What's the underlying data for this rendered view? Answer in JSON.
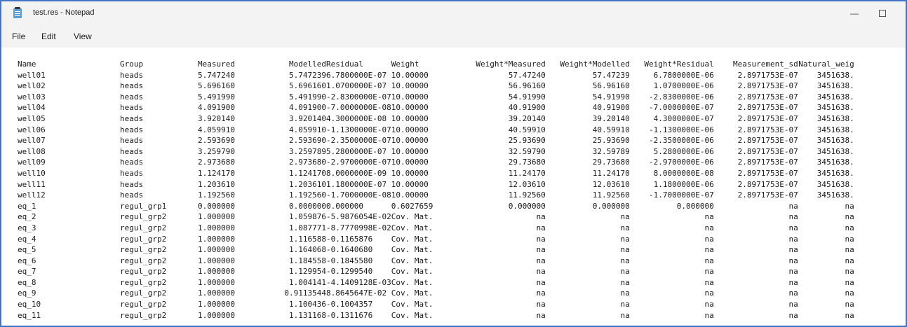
{
  "window": {
    "title": "test.res - Notepad",
    "minimize_glyph": "—",
    "icon": "notepad-icon"
  },
  "menu": [
    "File",
    "Edit",
    "View"
  ],
  "table": {
    "headers": [
      "Name",
      "Group",
      "Measured",
      "Modelled",
      "Residual",
      "Weight",
      "Weight*Measured",
      "Weight*Modelled",
      "Weight*Residual",
      "Measurement_sd",
      "Natural_weig"
    ],
    "rows": [
      [
        "well01",
        "heads",
        "5.747240",
        "5.747239",
        "6.7800000E-07",
        "10.00000",
        "57.47240",
        "57.47239",
        "6.7800000E-06",
        "2.8971753E-07",
        "3451638."
      ],
      [
        "well02",
        "heads",
        "5.696160",
        "5.696160",
        "1.0700000E-07",
        "10.00000",
        "56.96160",
        "56.96160",
        "1.0700000E-06",
        "2.8971753E-07",
        "3451638."
      ],
      [
        "well03",
        "heads",
        "5.491990",
        "5.491990",
        "-2.8300000E-07",
        "10.00000",
        "54.91990",
        "54.91990",
        "-2.8300000E-06",
        "2.8971753E-07",
        "3451638."
      ],
      [
        "well04",
        "heads",
        "4.091900",
        "4.091900",
        "-7.0000000E-08",
        "10.00000",
        "40.91900",
        "40.91900",
        "-7.0000000E-07",
        "2.8971753E-07",
        "3451638."
      ],
      [
        "well05",
        "heads",
        "3.920140",
        "3.920140",
        "4.3000000E-08",
        "10.00000",
        "39.20140",
        "39.20140",
        "4.3000000E-07",
        "2.8971753E-07",
        "3451638."
      ],
      [
        "well06",
        "heads",
        "4.059910",
        "4.059910",
        "-1.1300000E-07",
        "10.00000",
        "40.59910",
        "40.59910",
        "-1.1300000E-06",
        "2.8971753E-07",
        "3451638."
      ],
      [
        "well07",
        "heads",
        "2.593690",
        "2.593690",
        "-2.3500000E-07",
        "10.00000",
        "25.93690",
        "25.93690",
        "-2.3500000E-06",
        "2.8971753E-07",
        "3451638."
      ],
      [
        "well08",
        "heads",
        "3.259790",
        "3.259789",
        "5.2800000E-07",
        "10.00000",
        "32.59790",
        "32.59789",
        "5.2800000E-06",
        "2.8971753E-07",
        "3451638."
      ],
      [
        "well09",
        "heads",
        "2.973680",
        "2.973680",
        "-2.9700000E-07",
        "10.00000",
        "29.73680",
        "29.73680",
        "-2.9700000E-06",
        "2.8971753E-07",
        "3451638."
      ],
      [
        "well10",
        "heads",
        "1.124170",
        "1.124170",
        "8.0000000E-09",
        "10.00000",
        "11.24170",
        "11.24170",
        "8.0000000E-08",
        "2.8971753E-07",
        "3451638."
      ],
      [
        "well11",
        "heads",
        "1.203610",
        "1.203610",
        "1.1800000E-07",
        "10.00000",
        "12.03610",
        "12.03610",
        "1.1800000E-06",
        "2.8971753E-07",
        "3451638."
      ],
      [
        "well12",
        "heads",
        "1.192560",
        "1.192560",
        "-1.7000000E-08",
        "10.00000",
        "11.92560",
        "11.92560",
        "-1.7000000E-07",
        "2.8971753E-07",
        "3451638."
      ],
      [
        "eq_1",
        "regul_grp1",
        "0.000000",
        "0.000000",
        "0.000000",
        "0.6027659",
        "0.000000",
        "0.000000",
        "0.000000",
        "na",
        "na"
      ],
      [
        "eq_2",
        "regul_grp2",
        "1.000000",
        "1.059876",
        "-5.9876054E-02",
        "Cov. Mat.",
        "na",
        "na",
        "na",
        "na",
        "na"
      ],
      [
        "eq_3",
        "regul_grp2",
        "1.000000",
        "1.087771",
        "-8.7770998E-02",
        "Cov. Mat.",
        "na",
        "na",
        "na",
        "na",
        "na"
      ],
      [
        "eq_4",
        "regul_grp2",
        "1.000000",
        "1.116588",
        "-0.1165876",
        "Cov. Mat.",
        "na",
        "na",
        "na",
        "na",
        "na"
      ],
      [
        "eq_5",
        "regul_grp2",
        "1.000000",
        "1.164068",
        "-0.1640680",
        "Cov. Mat.",
        "na",
        "na",
        "na",
        "na",
        "na"
      ],
      [
        "eq_6",
        "regul_grp2",
        "1.000000",
        "1.184558",
        "-0.1845580",
        "Cov. Mat.",
        "na",
        "na",
        "na",
        "na",
        "na"
      ],
      [
        "eq_7",
        "regul_grp2",
        "1.000000",
        "1.129954",
        "-0.1299540",
        "Cov. Mat.",
        "na",
        "na",
        "na",
        "na",
        "na"
      ],
      [
        "eq_8",
        "regul_grp2",
        "1.000000",
        "1.004141",
        "-4.1409128E-03",
        "Cov. Mat.",
        "na",
        "na",
        "na",
        "na",
        "na"
      ],
      [
        "eq_9",
        "regul_grp2",
        "1.000000",
        "0.9113544",
        "8.8645647E-02",
        "Cov. Mat.",
        "na",
        "na",
        "na",
        "na",
        "na"
      ],
      [
        "eq_10",
        "regul_grp2",
        "1.000000",
        "1.100436",
        "-0.1004357",
        "Cov. Mat.",
        "na",
        "na",
        "na",
        "na",
        "na"
      ],
      [
        "eq_11",
        "regul_grp2",
        "1.000000",
        "1.131168",
        "-0.1311676",
        "Cov. Mat.",
        "na",
        "na",
        "na",
        "na",
        "na"
      ]
    ]
  },
  "colors": {
    "frame_border": "#4472c4",
    "chrome": "#f3f3f3",
    "text": "#1a1a1a"
  }
}
